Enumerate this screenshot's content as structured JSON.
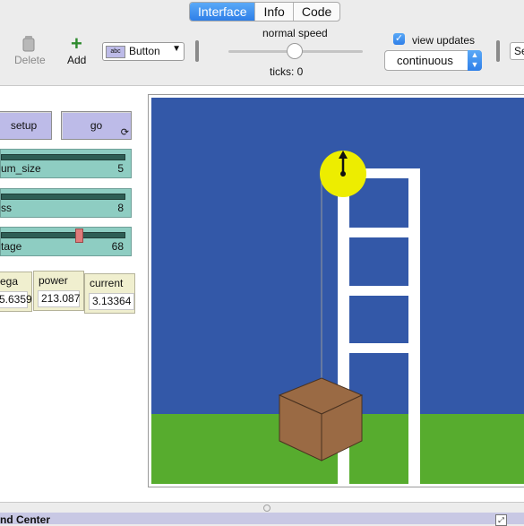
{
  "tabs": [
    {
      "label": "Interface",
      "active": true
    },
    {
      "label": "Info",
      "active": false
    },
    {
      "label": "Code",
      "active": false
    }
  ],
  "toolbar": {
    "delete_label": "Delete",
    "add_label": "Add",
    "widget_select": "Button",
    "widget_icon_text": "abc",
    "speed_label": "normal speed",
    "ticks_label": "ticks: 0",
    "view_updates_label": "view updates",
    "view_updates_checked": true,
    "update_mode": "continuous",
    "settings_partial": "Se"
  },
  "buttons": {
    "setup": "setup",
    "go": "go"
  },
  "sliders": [
    {
      "name": "um_size",
      "value": "5",
      "fraction": 1.0
    },
    {
      "name": "ss",
      "value": "8",
      "fraction": 1.0
    },
    {
      "name": "tage",
      "value": "68",
      "fraction": 0.64
    }
  ],
  "monitors": [
    {
      "label": "ega",
      "value": "5.6359"
    },
    {
      "label": "power",
      "value": "213.087"
    },
    {
      "label": "current",
      "value": "3.13364"
    }
  ],
  "command_center": "nd Center",
  "colors": {
    "sky": "#3358a8",
    "ground": "#57ac2e",
    "box": "#9a6a44",
    "motor": "#f0f000",
    "tab_active": "#2f7fe8",
    "button": "#bdbbe8",
    "slider": "#8ecdc2",
    "monitor": "#f0efcf"
  }
}
